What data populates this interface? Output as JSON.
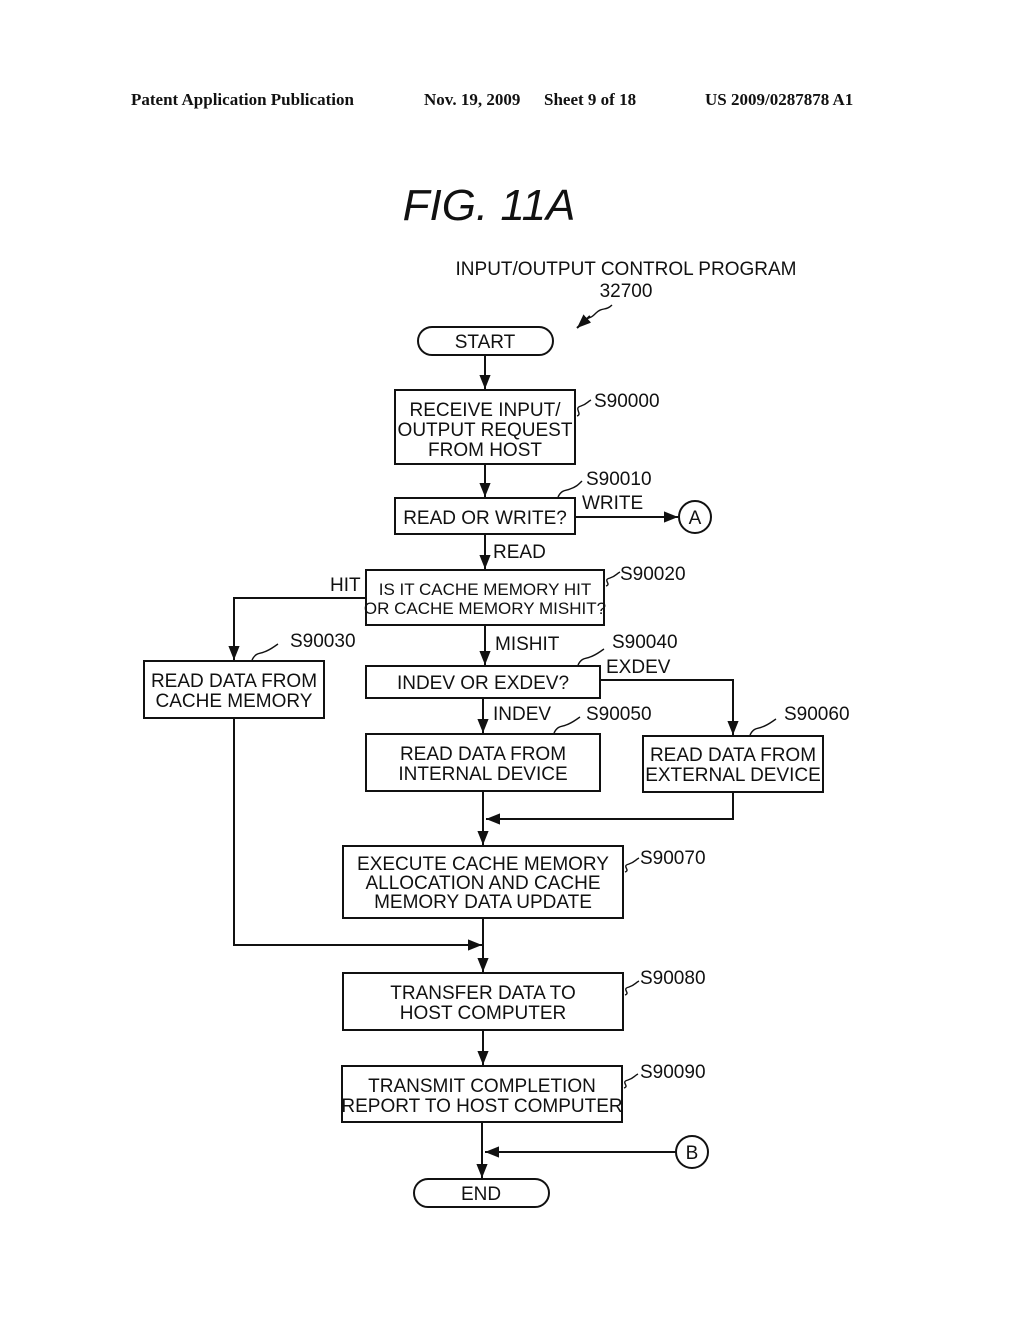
{
  "header": {
    "left": "Patent Application Publication",
    "date": "Nov. 19, 2009",
    "sheet": "Sheet 9 of 18",
    "number": "US 2009/0287878 A1"
  },
  "figure": {
    "title": "FIG.  11A",
    "program_name": "INPUT/OUTPUT CONTROL PROGRAM",
    "program_ref": "32700"
  },
  "flow": {
    "start": "START",
    "end": "END",
    "steps": {
      "s90000": {
        "ref": "S90000",
        "lines": [
          "RECEIVE INPUT/",
          "OUTPUT REQUEST",
          "FROM HOST"
        ]
      },
      "s90010": {
        "ref": "S90010",
        "lines": [
          "READ OR WRITE?"
        ]
      },
      "s90020": {
        "ref": "S90020",
        "lines": [
          "IS IT CACHE MEMORY HIT",
          "OR CACHE MEMORY MISHIT?"
        ]
      },
      "s90030": {
        "ref": "S90030",
        "lines": [
          "READ DATA FROM",
          "CACHE MEMORY"
        ]
      },
      "s90040": {
        "ref": "S90040",
        "lines": [
          "INDEV OR EXDEV?"
        ]
      },
      "s90050": {
        "ref": "S90050",
        "lines": [
          "READ DATA FROM",
          "INTERNAL DEVICE"
        ]
      },
      "s90060": {
        "ref": "S90060",
        "lines": [
          "READ DATA FROM",
          "EXTERNAL DEVICE"
        ]
      },
      "s90070": {
        "ref": "S90070",
        "lines": [
          "EXECUTE CACHE MEMORY",
          "ALLOCATION AND CACHE",
          "MEMORY DATA UPDATE"
        ]
      },
      "s90080": {
        "ref": "S90080",
        "lines": [
          "TRANSFER DATA TO",
          "HOST COMPUTER"
        ]
      },
      "s90090": {
        "ref": "S90090",
        "lines": [
          "TRANSMIT COMPLETION",
          "REPORT TO HOST COMPUTER"
        ]
      }
    },
    "branch_labels": {
      "write": "WRITE",
      "read": "READ",
      "hit": "HIT",
      "mishit": "MISHIT",
      "exdev": "EXDEV",
      "indev": "INDEV"
    },
    "connectors": {
      "a": "A",
      "b": "B"
    }
  }
}
